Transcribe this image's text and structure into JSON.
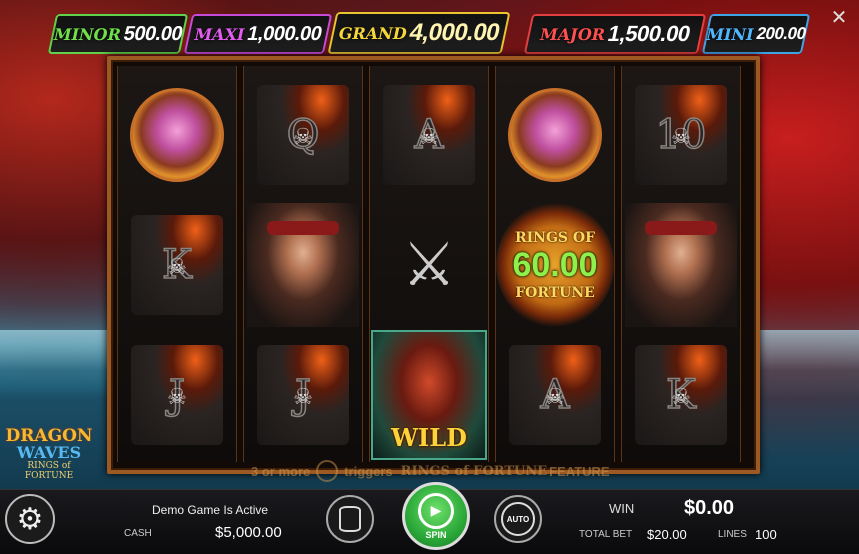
{
  "jackpots": {
    "minor": {
      "label": "MINOR",
      "value": "500.00"
    },
    "maxi": {
      "label": "MAXI",
      "value": "1,000.00"
    },
    "grand": {
      "label": "GRAND",
      "value": "4,000.00"
    },
    "major": {
      "label": "MAJOR",
      "value": "1,500.00"
    },
    "mini": {
      "label": "MINI",
      "value": "200.00"
    }
  },
  "close_icon": "✕",
  "reels": [
    [
      "compass",
      "K",
      "J"
    ],
    [
      "Q",
      "pirate",
      "J"
    ],
    [
      "A",
      "swords",
      "WILD"
    ],
    [
      "compass",
      "rings",
      "A"
    ],
    [
      "10",
      "pirate",
      "K"
    ]
  ],
  "rings_symbol": {
    "top": "RINGS OF",
    "value": "60.00",
    "bottom": "FORTUNE"
  },
  "wild_label": "WILD",
  "logo": {
    "line1": "DRAGON",
    "line2": "WAVES",
    "line3": "RINGS of FORTUNE"
  },
  "feature_text": {
    "part1": "3 or more",
    "part2": "triggers",
    "part3": "RINGS of FORTUNE",
    "part4": "FEATURE"
  },
  "bottom": {
    "demo_status": "Demo Game Is Active",
    "cash_label": "CASH",
    "cash_value": "$5,000.00",
    "spin_label": "SPIN",
    "auto_label": "AUTO",
    "win_label": "WIN",
    "win_value": "$0.00",
    "total_bet_label": "TOTAL BET",
    "total_bet_value": "$20.00",
    "lines_label": "LINES",
    "lines_value": "100"
  },
  "colors": {
    "minor": "#6fe04a",
    "maxi": "#e25cf0",
    "grand": "#f5d73a",
    "major": "#ff5050",
    "mini": "#4fb8ff",
    "spin_button": "#2aa838",
    "reel_frame": "#9c5a22"
  }
}
